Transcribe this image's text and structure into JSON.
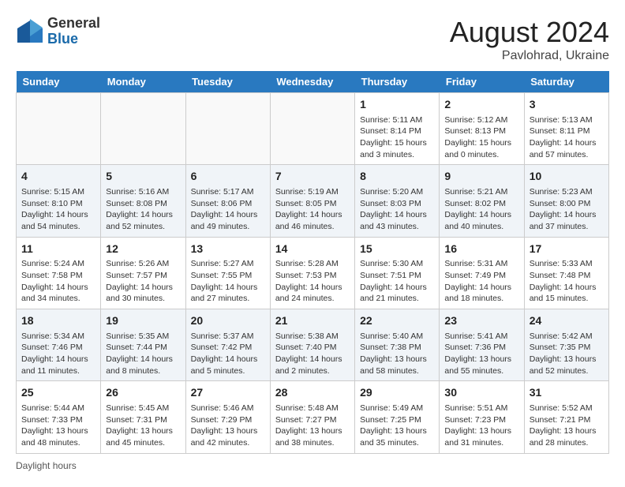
{
  "header": {
    "logo_general": "General",
    "logo_blue": "Blue",
    "month_year": "August 2024",
    "location": "Pavlohrad, Ukraine"
  },
  "weekdays": [
    "Sunday",
    "Monday",
    "Tuesday",
    "Wednesday",
    "Thursday",
    "Friday",
    "Saturday"
  ],
  "footer": {
    "daylight_label": "Daylight hours"
  },
  "weeks": [
    [
      {
        "day": "",
        "info": ""
      },
      {
        "day": "",
        "info": ""
      },
      {
        "day": "",
        "info": ""
      },
      {
        "day": "",
        "info": ""
      },
      {
        "day": "1",
        "info": "Sunrise: 5:11 AM\nSunset: 8:14 PM\nDaylight: 15 hours\nand 3 minutes."
      },
      {
        "day": "2",
        "info": "Sunrise: 5:12 AM\nSunset: 8:13 PM\nDaylight: 15 hours\nand 0 minutes."
      },
      {
        "day": "3",
        "info": "Sunrise: 5:13 AM\nSunset: 8:11 PM\nDaylight: 14 hours\nand 57 minutes."
      }
    ],
    [
      {
        "day": "4",
        "info": "Sunrise: 5:15 AM\nSunset: 8:10 PM\nDaylight: 14 hours\nand 54 minutes."
      },
      {
        "day": "5",
        "info": "Sunrise: 5:16 AM\nSunset: 8:08 PM\nDaylight: 14 hours\nand 52 minutes."
      },
      {
        "day": "6",
        "info": "Sunrise: 5:17 AM\nSunset: 8:06 PM\nDaylight: 14 hours\nand 49 minutes."
      },
      {
        "day": "7",
        "info": "Sunrise: 5:19 AM\nSunset: 8:05 PM\nDaylight: 14 hours\nand 46 minutes."
      },
      {
        "day": "8",
        "info": "Sunrise: 5:20 AM\nSunset: 8:03 PM\nDaylight: 14 hours\nand 43 minutes."
      },
      {
        "day": "9",
        "info": "Sunrise: 5:21 AM\nSunset: 8:02 PM\nDaylight: 14 hours\nand 40 minutes."
      },
      {
        "day": "10",
        "info": "Sunrise: 5:23 AM\nSunset: 8:00 PM\nDaylight: 14 hours\nand 37 minutes."
      }
    ],
    [
      {
        "day": "11",
        "info": "Sunrise: 5:24 AM\nSunset: 7:58 PM\nDaylight: 14 hours\nand 34 minutes."
      },
      {
        "day": "12",
        "info": "Sunrise: 5:26 AM\nSunset: 7:57 PM\nDaylight: 14 hours\nand 30 minutes."
      },
      {
        "day": "13",
        "info": "Sunrise: 5:27 AM\nSunset: 7:55 PM\nDaylight: 14 hours\nand 27 minutes."
      },
      {
        "day": "14",
        "info": "Sunrise: 5:28 AM\nSunset: 7:53 PM\nDaylight: 14 hours\nand 24 minutes."
      },
      {
        "day": "15",
        "info": "Sunrise: 5:30 AM\nSunset: 7:51 PM\nDaylight: 14 hours\nand 21 minutes."
      },
      {
        "day": "16",
        "info": "Sunrise: 5:31 AM\nSunset: 7:49 PM\nDaylight: 14 hours\nand 18 minutes."
      },
      {
        "day": "17",
        "info": "Sunrise: 5:33 AM\nSunset: 7:48 PM\nDaylight: 14 hours\nand 15 minutes."
      }
    ],
    [
      {
        "day": "18",
        "info": "Sunrise: 5:34 AM\nSunset: 7:46 PM\nDaylight: 14 hours\nand 11 minutes."
      },
      {
        "day": "19",
        "info": "Sunrise: 5:35 AM\nSunset: 7:44 PM\nDaylight: 14 hours\nand 8 minutes."
      },
      {
        "day": "20",
        "info": "Sunrise: 5:37 AM\nSunset: 7:42 PM\nDaylight: 14 hours\nand 5 minutes."
      },
      {
        "day": "21",
        "info": "Sunrise: 5:38 AM\nSunset: 7:40 PM\nDaylight: 14 hours\nand 2 minutes."
      },
      {
        "day": "22",
        "info": "Sunrise: 5:40 AM\nSunset: 7:38 PM\nDaylight: 13 hours\nand 58 minutes."
      },
      {
        "day": "23",
        "info": "Sunrise: 5:41 AM\nSunset: 7:36 PM\nDaylight: 13 hours\nand 55 minutes."
      },
      {
        "day": "24",
        "info": "Sunrise: 5:42 AM\nSunset: 7:35 PM\nDaylight: 13 hours\nand 52 minutes."
      }
    ],
    [
      {
        "day": "25",
        "info": "Sunrise: 5:44 AM\nSunset: 7:33 PM\nDaylight: 13 hours\nand 48 minutes."
      },
      {
        "day": "26",
        "info": "Sunrise: 5:45 AM\nSunset: 7:31 PM\nDaylight: 13 hours\nand 45 minutes."
      },
      {
        "day": "27",
        "info": "Sunrise: 5:46 AM\nSunset: 7:29 PM\nDaylight: 13 hours\nand 42 minutes."
      },
      {
        "day": "28",
        "info": "Sunrise: 5:48 AM\nSunset: 7:27 PM\nDaylight: 13 hours\nand 38 minutes."
      },
      {
        "day": "29",
        "info": "Sunrise: 5:49 AM\nSunset: 7:25 PM\nDaylight: 13 hours\nand 35 minutes."
      },
      {
        "day": "30",
        "info": "Sunrise: 5:51 AM\nSunset: 7:23 PM\nDaylight: 13 hours\nand 31 minutes."
      },
      {
        "day": "31",
        "info": "Sunrise: 5:52 AM\nSunset: 7:21 PM\nDaylight: 13 hours\nand 28 minutes."
      }
    ]
  ]
}
